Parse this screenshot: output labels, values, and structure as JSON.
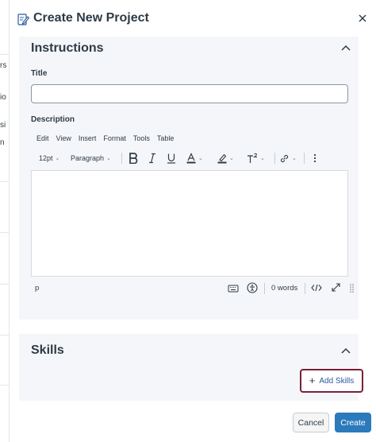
{
  "background_fragments": [
    "rs",
    "io",
    "si",
    "n"
  ],
  "dialog": {
    "title": "Create New Project",
    "edit_icon": "edit-icon",
    "close_icon": "close-icon"
  },
  "instructions": {
    "heading": "Instructions",
    "collapse_icon": "chevron-up-icon",
    "title_label": "Title",
    "title_value": "",
    "description_label": "Description"
  },
  "editor": {
    "menu": [
      "Edit",
      "View",
      "Insert",
      "Format",
      "Tools",
      "Table"
    ],
    "font_size": "12pt",
    "block_format": "Paragraph",
    "toolbar_icons": [
      "bold-icon",
      "italic-icon",
      "underline-icon",
      "text-color-icon",
      "highlight-icon",
      "superscript-icon",
      "link-icon",
      "more-icon"
    ],
    "path": "p",
    "word_count": "0 words",
    "status_icons": [
      "keyboard-icon",
      "accessibility-icon",
      "html-code-icon",
      "fullscreen-icon",
      "resize-handle-icon"
    ]
  },
  "skills": {
    "heading": "Skills",
    "collapse_icon": "chevron-up-icon",
    "add_label": "Add Skills"
  },
  "footer": {
    "cancel_label": "Cancel",
    "create_label": "Create"
  },
  "colors": {
    "primary": "#2b7abc",
    "focus_ring": "#7a1f37",
    "panel_bg": "#f5f6fa",
    "link": "#2b5c9c"
  }
}
